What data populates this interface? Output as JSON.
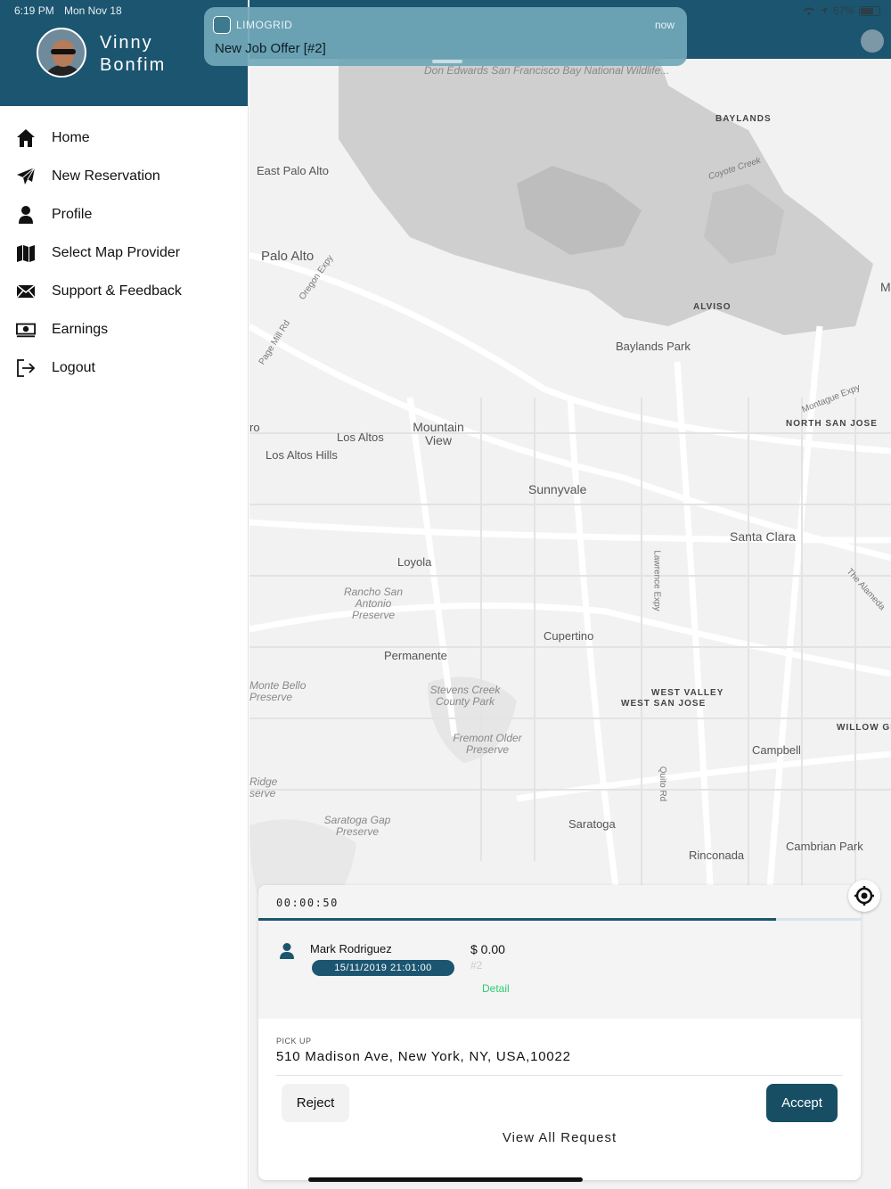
{
  "status_bar": {
    "time": "6:19 PM",
    "date": "Mon Nov 18",
    "battery": "67%"
  },
  "notification": {
    "app_name": "LIMOGRID",
    "time": "now",
    "message": "New Job Offer [#2]"
  },
  "user": {
    "name": "Vinny Bonfim"
  },
  "menu": {
    "items": [
      {
        "label": "Home",
        "icon": "home-icon"
      },
      {
        "label": "New Reservation",
        "icon": "paper-plane-icon"
      },
      {
        "label": "Profile",
        "icon": "user-icon"
      },
      {
        "label": "Select Map Provider",
        "icon": "map-icon"
      },
      {
        "label": "Support & Feedback",
        "icon": "envelope-icon"
      },
      {
        "label": "Earnings",
        "icon": "money-icon"
      },
      {
        "label": "Logout",
        "icon": "logout-icon"
      }
    ]
  },
  "map": {
    "labels": {
      "don_edwards": "Don Edwards San Francisco Bay National Wildlife...",
      "baylands": "BAYLANDS",
      "east_palo_alto": "East Palo Alto",
      "palo_alto": "Palo Alto",
      "oregon_expy": "Oregon Expy",
      "page_mill": "Page Mill Rd",
      "coyote_creek": "Coyote Creek",
      "alviso": "ALVISO",
      "baylands_park": "Baylands Park",
      "montague": "Montague Expy",
      "north_san_jose": "NORTH SAN JOSE",
      "mountain_view": "Mountain View",
      "los_altos": "Los Altos",
      "los_altos_hills": "Los Altos Hills",
      "sunnyvale": "Sunnyvale",
      "santa_clara": "Santa Clara",
      "loyola": "Loyola",
      "lawrence": "Lawrence Expy",
      "the_alameda": "The Alameda",
      "rancho": "Rancho San Antonio Preserve",
      "cupertino": "Cupertino",
      "permanente": "Permanente",
      "monte_bello": "Monte Bello Preserve",
      "stevens_creek": "Stevens Creek County Park",
      "west_valley": "WEST VALLEY",
      "west_san_jose": "WEST SAN JOSE",
      "willow_glen": "WILLOW GL",
      "fremont_older": "Fremont Older Preserve",
      "campbell": "Campbell",
      "quito": "Quito Rd",
      "ridge": "Ridge serve",
      "saratoga": "Saratoga",
      "saratoga_gap": "Saratoga Gap Preserve",
      "cambrian": "Cambrian Park",
      "rinconada": "Rinconada",
      "edge_m": "M",
      "edge_ro": "ro"
    }
  },
  "request": {
    "timer": "00:00:50",
    "progress": 0.86,
    "passenger": "Mark Rodriguez",
    "datetime": "15/11/2019 21:01:00",
    "price": "$ 0.00",
    "job_id": "#2",
    "detail_label": "Detail",
    "pickup_label": "PICK UP",
    "pickup_address": "510 Madison Ave, New York, NY, USA,10022",
    "reject_label": "Reject",
    "accept_label": "Accept",
    "view_all_label": "View All Request"
  },
  "colors": {
    "primary": "#1c5570",
    "accent_green": "#2ecc71",
    "notification": "#71a8b8"
  }
}
